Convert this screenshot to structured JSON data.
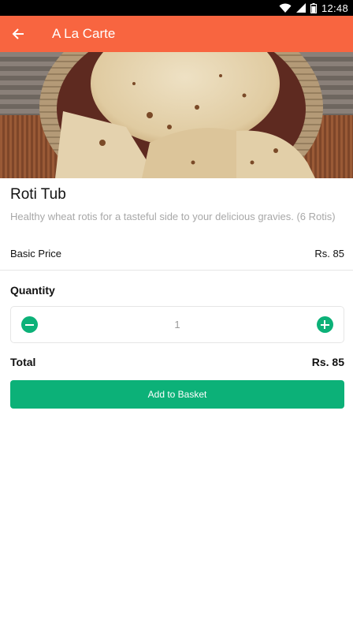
{
  "status_bar": {
    "time": "12:48",
    "icons": [
      "wifi-icon",
      "signal-icon",
      "battery-icon"
    ]
  },
  "app_bar": {
    "title": "A La Carte",
    "back_icon": "arrow-left-icon",
    "color": "#f86540"
  },
  "hero_image": {
    "description_icon": "roti-photo"
  },
  "item": {
    "name": "Roti Tub",
    "description": "Healthy wheat rotis for a tasteful side to your delicious gravies. (6 Rotis)",
    "basic_price_label": "Basic Price",
    "basic_price_value": "Rs. 85"
  },
  "quantity": {
    "label": "Quantity",
    "value": "1",
    "minus_icon": "minus-circle-icon",
    "plus_icon": "plus-circle-icon"
  },
  "total": {
    "label": "Total",
    "value": "Rs. 85"
  },
  "actions": {
    "add_to_basket_label": "Add to Basket",
    "accent": "#0cb178"
  }
}
